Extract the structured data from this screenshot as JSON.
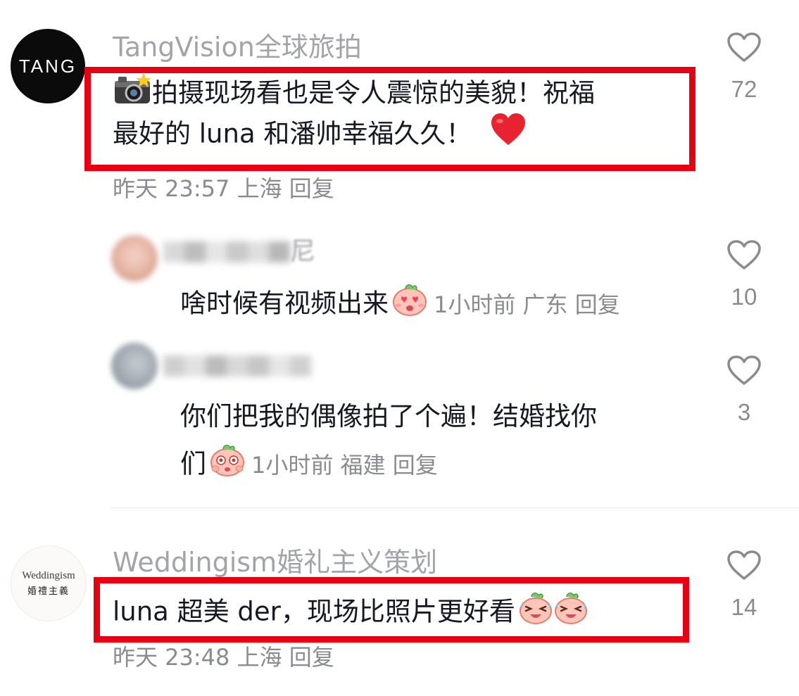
{
  "comments": [
    {
      "avatar_text": "TANG",
      "username": "TangVision全球旅拍",
      "line1_text": "拍摄现场看也是令人震惊的美貌！祝福",
      "line2_text": "最好的 luna 和潘帅幸福久久！",
      "icons": [
        "camera-flash-emoji",
        "red-heart-emoji"
      ],
      "time": "昨天 23:57",
      "location": "上海",
      "reply_label": "回复",
      "likes": "72",
      "highlighted": true
    },
    {
      "username_partial": "尼",
      "text": "啥时候有视频出来",
      "icons": [
        "heart-eyes-emoji"
      ],
      "time": "1小时前",
      "location": "广东",
      "reply_label": "回复",
      "likes": "10"
    },
    {
      "line1_text": "你们把我的偶像拍了个遍！结婚找你",
      "line2_text": "们",
      "icons": [
        "starry-eyes-emoji"
      ],
      "time": "1小时前",
      "location": "福建",
      "reply_label": "回复",
      "likes": "3"
    },
    {
      "avatar_brand": "Weddingism",
      "avatar_sub": "婚禮主義",
      "username": "Weddingism婚礼主义策划",
      "text": "luna 超美 der，现场比照片更好看",
      "icons": [
        "laughing-tears-emoji",
        "laughing-tears-emoji"
      ],
      "time": "昨天 23:48",
      "location": "上海",
      "reply_label": "回复",
      "likes": "14",
      "highlighted": true
    }
  ],
  "colors": {
    "highlight_frame": "#e60012",
    "username_gray": "#a3a4a9",
    "meta_gray": "#8a8b91",
    "text_dark": "#161823"
  }
}
